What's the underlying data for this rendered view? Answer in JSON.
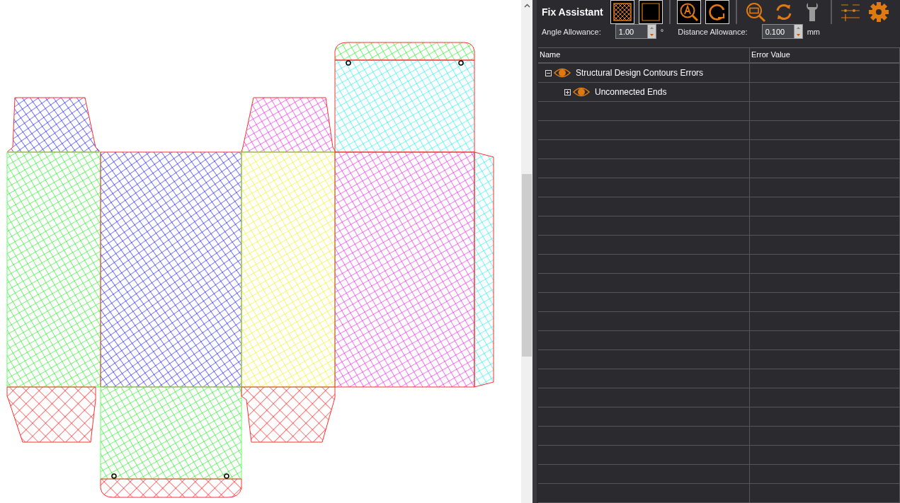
{
  "panel": {
    "title": "Fix Assistant"
  },
  "allowances": [
    {
      "label": "Angle Allowance:",
      "value": "1.00",
      "unit": "°"
    },
    {
      "label": "Distance Allowance:",
      "value": "0.100",
      "unit": "mm"
    }
  ],
  "table": {
    "columns": [
      "Name",
      "Error Value"
    ],
    "rows": [
      {
        "name": "Structural Design Contours Errors",
        "expanded": true,
        "children": [
          {
            "name": "Unconnected Ends",
            "expanded": false
          }
        ]
      }
    ]
  }
}
